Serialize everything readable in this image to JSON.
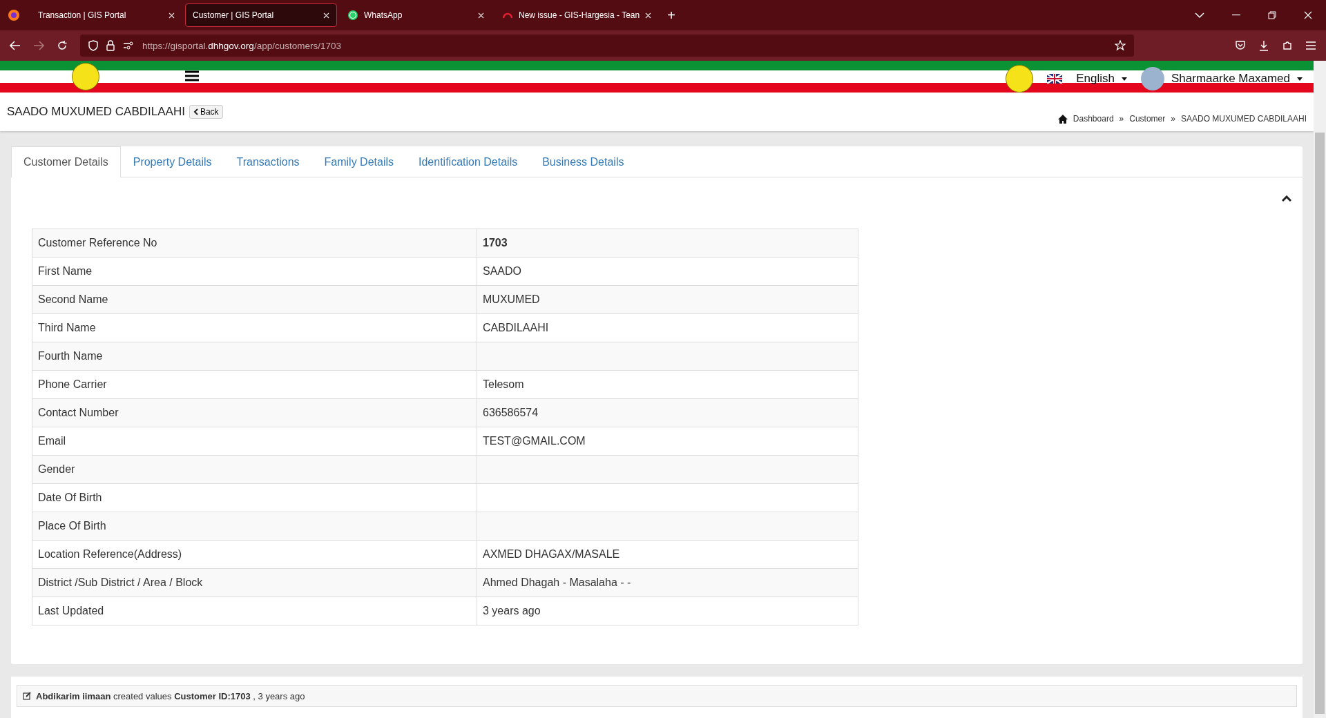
{
  "browser": {
    "tabs": [
      {
        "title": "Transaction | GIS Portal",
        "kind": "plain",
        "selected": false
      },
      {
        "title": "Customer | GIS Portal",
        "kind": "plain",
        "selected": true
      },
      {
        "title": "WhatsApp",
        "kind": "chat",
        "selected": false
      },
      {
        "title": "New issue - GIS-Hargesia - Tean",
        "kind": "loading",
        "selected": false
      }
    ],
    "new_tab": "+",
    "url": {
      "prefix": "https://gisportal.",
      "domain": "dhhgov.org",
      "path": "/app/customers/1703"
    }
  },
  "header": {
    "language": "English",
    "user": "Sharmaarke Maxamed"
  },
  "page": {
    "title": "SAADO MUXUMED CABDILAAHI",
    "back": "Back",
    "breadcrumb": [
      {
        "text": "Dashboard"
      },
      {
        "separator": "»",
        "text": "Customer"
      },
      {
        "separator": "»",
        "text": "SAADO MUXUMED CABDILAAHI"
      }
    ]
  },
  "tabs": [
    {
      "label": "Customer Details",
      "selected": true
    },
    {
      "label": "Property Details",
      "selected": false
    },
    {
      "label": "Transactions",
      "selected": false
    },
    {
      "label": "Family Details",
      "selected": false
    },
    {
      "label": "Identification Details",
      "selected": false
    },
    {
      "label": "Business Details",
      "selected": false
    }
  ],
  "details": [
    {
      "label": "Customer Reference No",
      "value": "1703",
      "bold": true
    },
    {
      "label": "First Name",
      "value": "SAADO",
      "bold": false
    },
    {
      "label": "Second Name",
      "value": "MUXUMED",
      "bold": false
    },
    {
      "label": "Third Name",
      "value": "CABDILAAHI",
      "bold": false
    },
    {
      "label": "Fourth Name"
    },
    {
      "label": "Phone Carrier",
      "value": "Telesom",
      "bold": false
    },
    {
      "label": "Contact Number",
      "value": "636586574",
      "bold": false
    },
    {
      "label": "Email",
      "value": "TEST@GMAIL.COM",
      "bold": false
    },
    {
      "label": "Gender"
    },
    {
      "label": "Date Of Birth"
    },
    {
      "label": "Place Of Birth"
    },
    {
      "label": "Location Reference(Address)",
      "value": "AXMED DHAGAX/MASALE",
      "bold": false
    },
    {
      "label": "District /Sub District / Area / Block",
      "value": "Ahmed Dhagah - Masalaha - -",
      "bold": false
    },
    {
      "label": "Last Updated",
      "value": "3 years ago",
      "bold": false
    }
  ],
  "activity": [
    "**Abdikarim iimaan** created values **Customer ID:1703** , 3 years ago"
  ]
}
